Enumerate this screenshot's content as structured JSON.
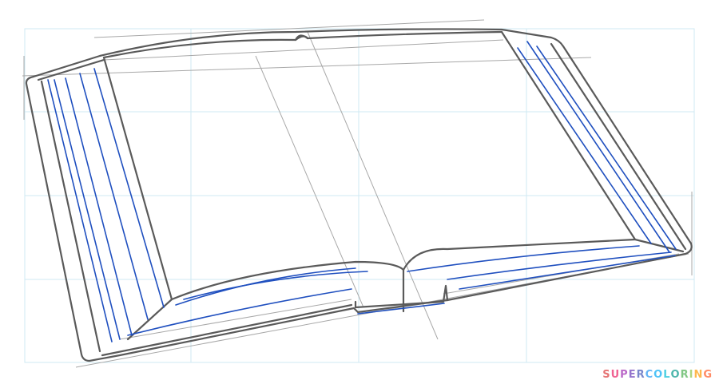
{
  "watermark": {
    "text": "SUPERCOLORING",
    "letter_colors": [
      "#e57373",
      "#f06292",
      "#ba68c8",
      "#9575cd",
      "#7986cb",
      "#64b5f6",
      "#4fc3f7",
      "#4dd0e1",
      "#4db6ac",
      "#81c784",
      "#aed581",
      "#ffb74d",
      "#ff8a65"
    ]
  },
  "colors": {
    "grid": "#cfeaf3",
    "construction": "#9e9e9e",
    "outline": "#555555",
    "accent": "#1f4fbf"
  }
}
